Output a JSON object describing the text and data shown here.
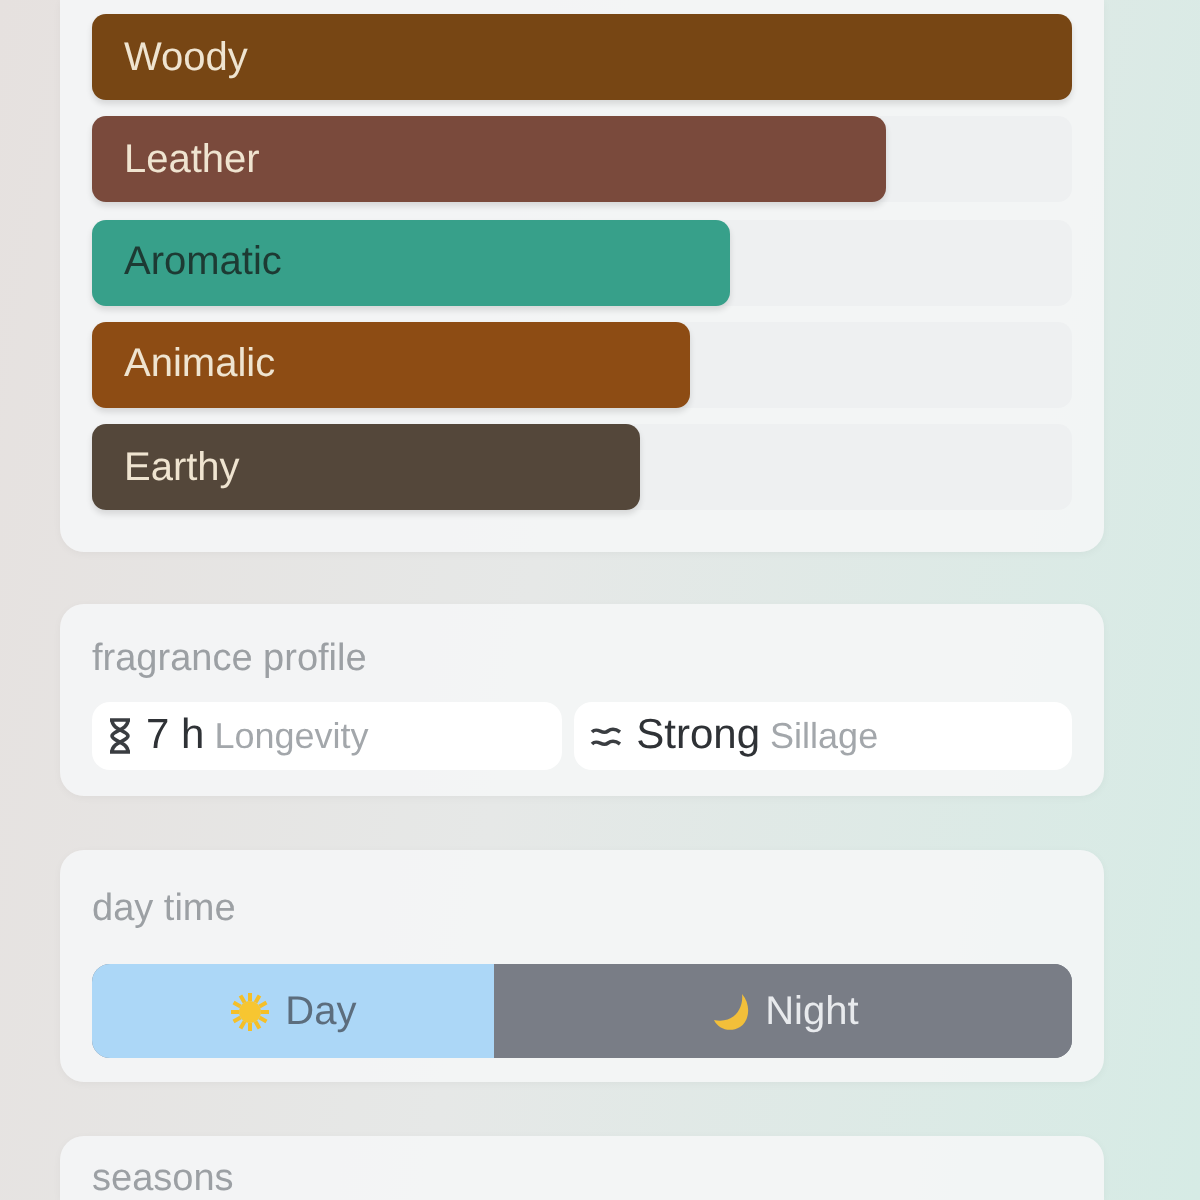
{
  "accords": [
    {
      "label": "Woody",
      "level": 1,
      "color": "#774614"
    },
    {
      "label": "Leather",
      "level": 0.81,
      "color": "#7a4a3c"
    },
    {
      "label": "Aromatic",
      "level": 0.65,
      "color": "#37a08a"
    },
    {
      "label": "Animalic",
      "level": 0.61,
      "color": "#8d4c14"
    },
    {
      "label": "Earthy",
      "level": 0.56,
      "color": "#54473a"
    }
  ],
  "fragrance_profile": {
    "title": "fragrance profile",
    "items": [
      {
        "kind": "longevity",
        "value": "7 h",
        "label": "Longevity"
      },
      {
        "kind": "sillage",
        "value": "Strong",
        "label": "Sillage"
      }
    ]
  },
  "day_time": {
    "title": "day time",
    "options": [
      {
        "kind": "day",
        "label": "Day",
        "level": 0.41,
        "color": "#acd7f7"
      },
      {
        "kind": "night",
        "label": "Night",
        "level": 0.59,
        "color": "#797d86"
      }
    ]
  },
  "seasons": {
    "title": "seasons"
  }
}
